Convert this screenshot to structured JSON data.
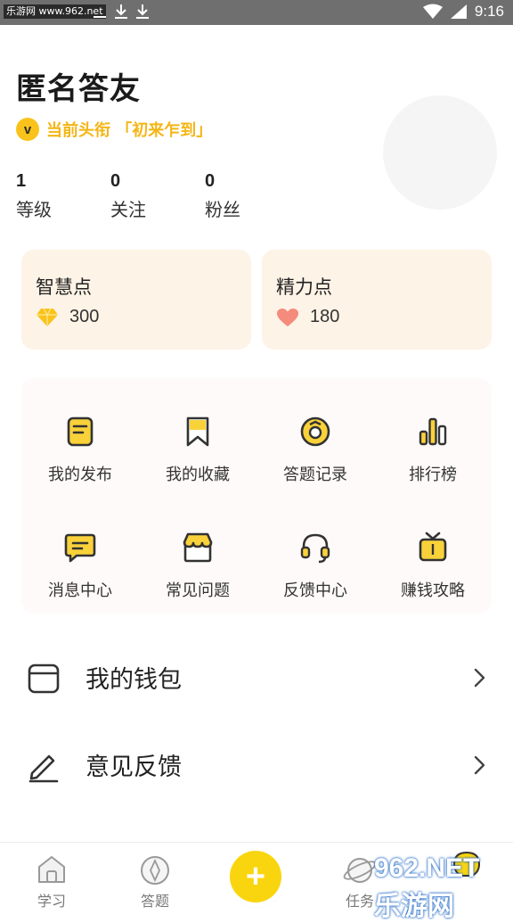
{
  "status_bar": {
    "watermark": "乐游网 www.962.net",
    "time": "9:16"
  },
  "profile": {
    "username": "匿名答友",
    "title": "当前头衔 「初来乍到」",
    "badge_letter": "v",
    "stats": [
      {
        "value": "1",
        "label": "等级"
      },
      {
        "value": "0",
        "label": "关注"
      },
      {
        "value": "0",
        "label": "粉丝"
      }
    ]
  },
  "points": [
    {
      "title": "智慧点",
      "value": "300",
      "icon": "diamond-icon"
    },
    {
      "title": "精力点",
      "value": "180",
      "icon": "heart-icon"
    }
  ],
  "grid": [
    {
      "label": "我的发布",
      "icon": "clipboard-icon"
    },
    {
      "label": "我的收藏",
      "icon": "bookmark-icon"
    },
    {
      "label": "答题记录",
      "icon": "record-icon"
    },
    {
      "label": "排行榜",
      "icon": "bar-chart-icon"
    },
    {
      "label": "消息中心",
      "icon": "message-icon"
    },
    {
      "label": "常见问题",
      "icon": "shop-icon"
    },
    {
      "label": "反馈中心",
      "icon": "headset-icon"
    },
    {
      "label": "赚钱攻略",
      "icon": "tv-icon"
    }
  ],
  "list": [
    {
      "label": "我的钱包",
      "icon": "wallet-icon"
    },
    {
      "label": "意见反馈",
      "icon": "pencil-icon"
    }
  ],
  "bottom_nav": [
    {
      "label": "学习",
      "icon": "home-icon"
    },
    {
      "label": "答题",
      "icon": "compass-icon"
    },
    {
      "label": "",
      "icon": "plus-icon"
    },
    {
      "label": "任务",
      "icon": "planet-icon"
    }
  ],
  "watermark_logo": "962.NET 乐游网",
  "colors": {
    "accent": "#f9c31b",
    "title_text": "#f4b616",
    "card_bg": "#fdf3e6",
    "grid_bg": "#fffafa"
  }
}
